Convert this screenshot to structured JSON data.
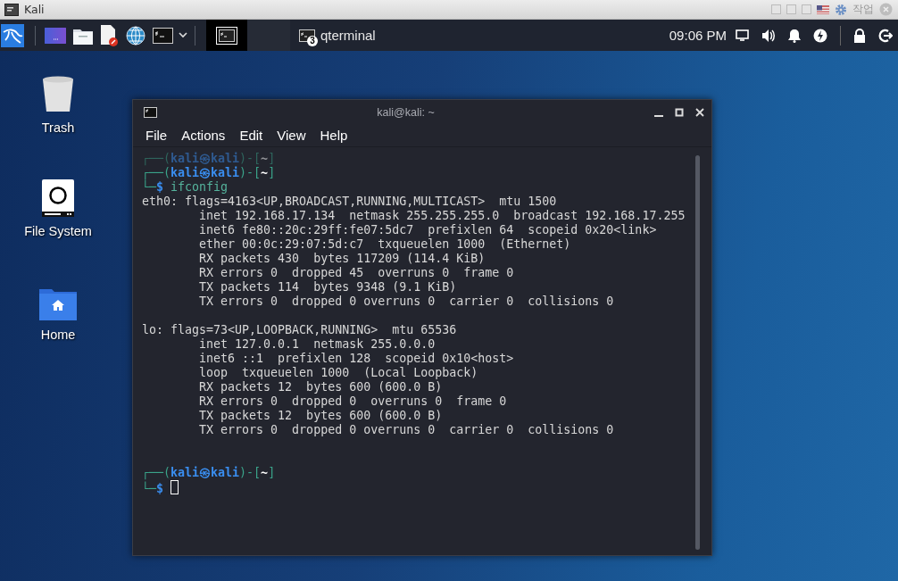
{
  "host_window": {
    "title": "Kali",
    "tray_label": "작업"
  },
  "panel": {
    "tasks": [
      {
        "kind": "icon",
        "selected": true
      },
      {
        "kind": "blank",
        "selected": false
      },
      {
        "kind": "group",
        "label": "qterminal",
        "badge": "3",
        "selected": false
      }
    ],
    "clock": "09:06 PM"
  },
  "desktop_icons": [
    {
      "kind": "trash",
      "label": "Trash"
    },
    {
      "kind": "drive",
      "label": "File System"
    },
    {
      "kind": "home",
      "label": "Home"
    }
  ],
  "terminal": {
    "title": "kali@kali: ~",
    "menu": [
      "File",
      "Actions",
      "Edit",
      "View",
      "Help"
    ],
    "lines": [
      {
        "kind": "ghost",
        "open": "┌──(",
        "user_host": "kali㉿kali",
        "mid": ")-[",
        "dir": "~",
        "close": "]"
      },
      {
        "kind": "prompt",
        "open": "┌──(",
        "user_host": "kali㉿kali",
        "mid": ")-[",
        "dir": "~",
        "close": "]"
      },
      {
        "kind": "command",
        "prefix": "└─",
        "symbol": "$",
        "command": "ifconfig",
        "cursor": false
      },
      {
        "kind": "output",
        "text": "eth0: flags=4163<UP,BROADCAST,RUNNING,MULTICAST>  mtu 1500"
      },
      {
        "kind": "output",
        "text": "        inet 192.168.17.134  netmask 255.255.255.0  broadcast 192.168.17.255"
      },
      {
        "kind": "output",
        "text": "        inet6 fe80::20c:29ff:fe07:5dc7  prefixlen 64  scopeid 0x20<link>"
      },
      {
        "kind": "output",
        "text": "        ether 00:0c:29:07:5d:c7  txqueuelen 1000  (Ethernet)"
      },
      {
        "kind": "output",
        "text": "        RX packets 430  bytes 117209 (114.4 KiB)"
      },
      {
        "kind": "output",
        "text": "        RX errors 0  dropped 45  overruns 0  frame 0"
      },
      {
        "kind": "output",
        "text": "        TX packets 114  bytes 9348 (9.1 KiB)"
      },
      {
        "kind": "output",
        "text": "        TX errors 0  dropped 0 overruns 0  carrier 0  collisions 0"
      },
      {
        "kind": "blank"
      },
      {
        "kind": "output",
        "text": "lo: flags=73<UP,LOOPBACK,RUNNING>  mtu 65536"
      },
      {
        "kind": "output",
        "text": "        inet 127.0.0.1  netmask 255.0.0.0"
      },
      {
        "kind": "output",
        "text": "        inet6 ::1  prefixlen 128  scopeid 0x10<host>"
      },
      {
        "kind": "output",
        "text": "        loop  txqueuelen 1000  (Local Loopback)"
      },
      {
        "kind": "output",
        "text": "        RX packets 12  bytes 600 (600.0 B)"
      },
      {
        "kind": "output",
        "text": "        RX errors 0  dropped 0  overruns 0  frame 0"
      },
      {
        "kind": "output",
        "text": "        TX packets 12  bytes 600 (600.0 B)"
      },
      {
        "kind": "output",
        "text": "        TX errors 0  dropped 0 overruns 0  carrier 0  collisions 0"
      },
      {
        "kind": "blank"
      },
      {
        "kind": "blank"
      },
      {
        "kind": "prompt",
        "open": "┌──(",
        "user_host": "kali㉿kali",
        "mid": ")-[",
        "dir": "~",
        "close": "]"
      },
      {
        "kind": "command",
        "prefix": "└─",
        "symbol": "$",
        "cursor": true
      }
    ]
  }
}
